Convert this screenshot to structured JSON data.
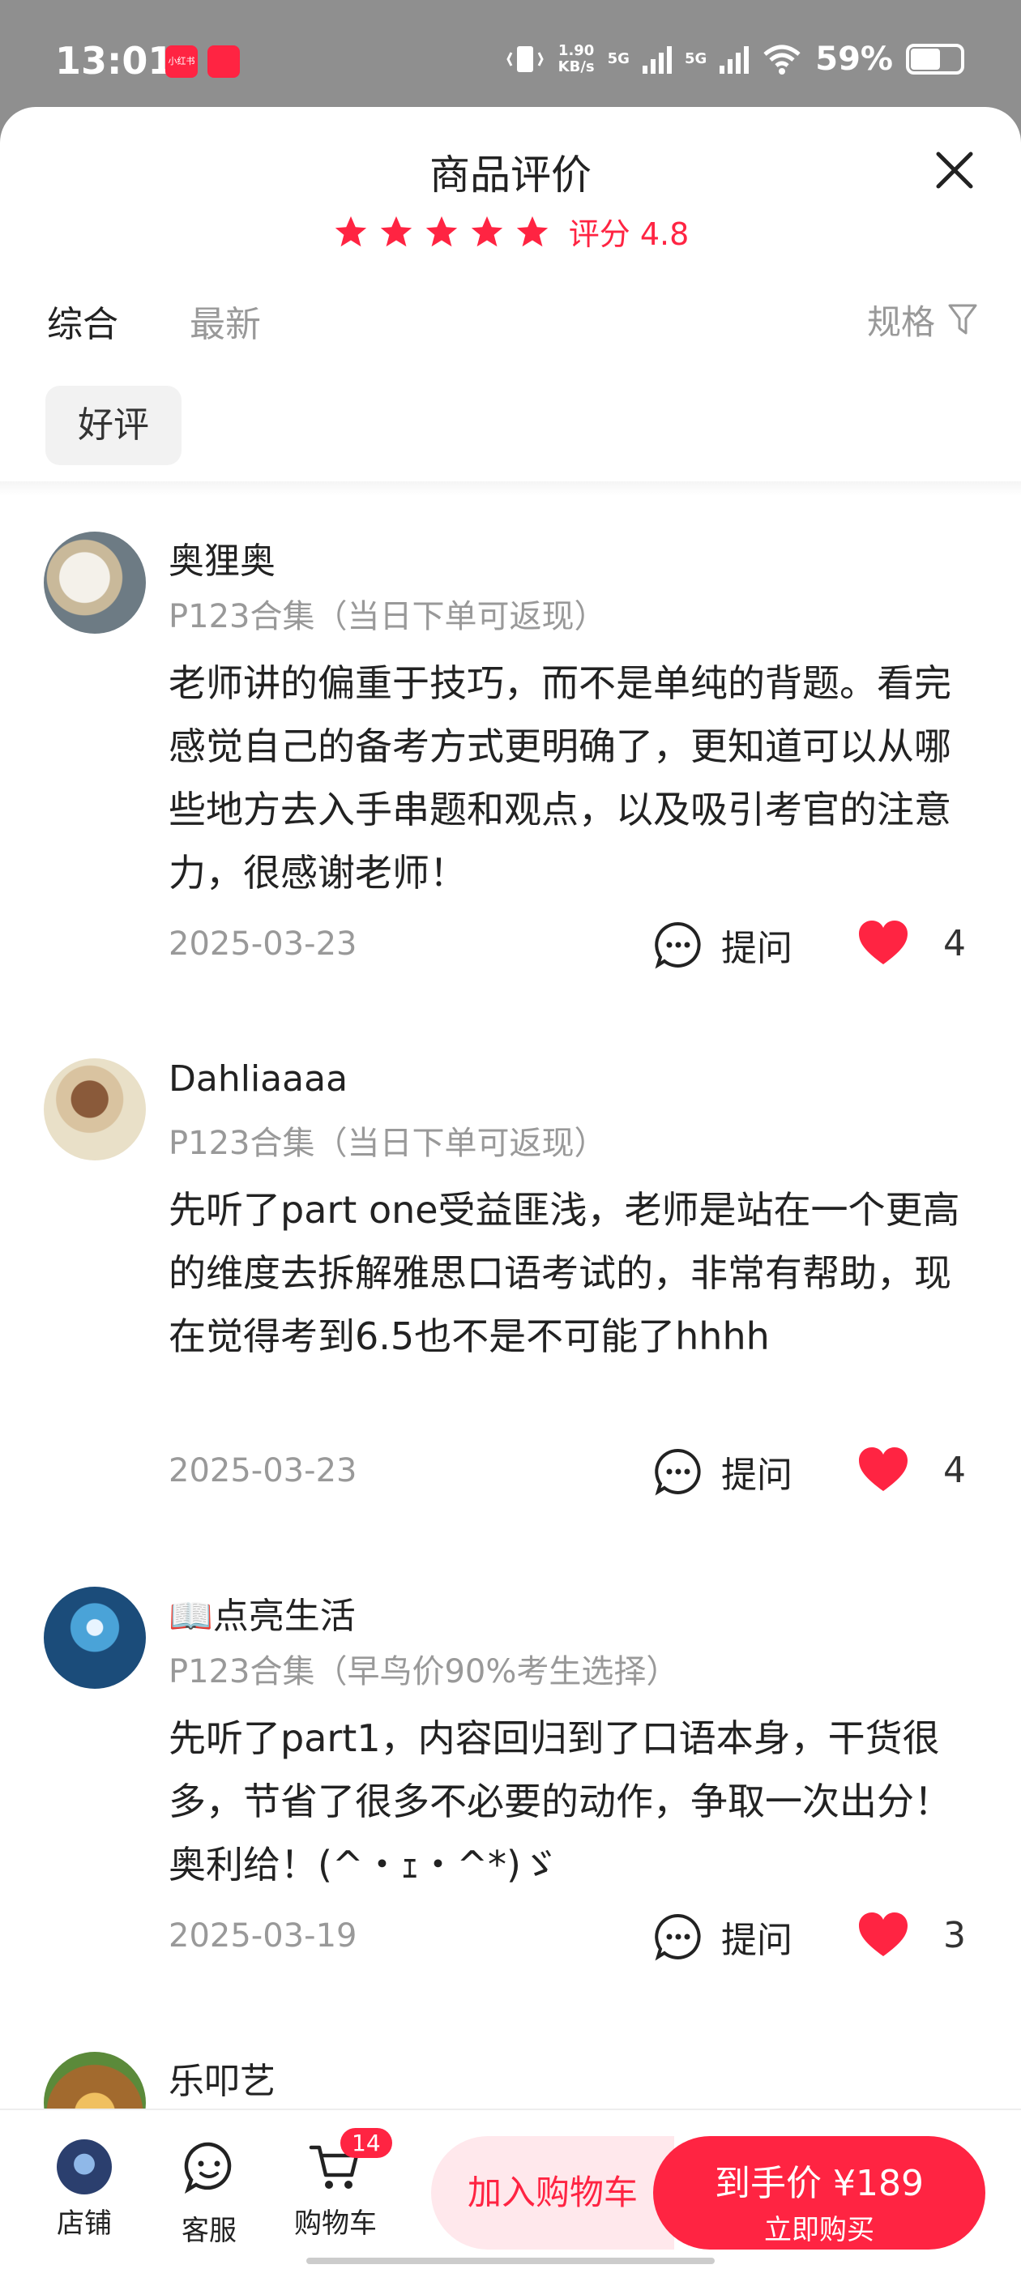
{
  "status_bar": {
    "time": "13:01",
    "net_speed_top": "1.90",
    "net_speed_bottom": "KB/s",
    "sim1": "5G",
    "sim2": "5G",
    "battery": "59%",
    "app1_label": "小红书"
  },
  "sheet": {
    "title": "商品评价",
    "rating_label": "评分 4.8",
    "rating_stars": 5,
    "accent_color": "#ff2442"
  },
  "tabs": {
    "comprehensive": "综合",
    "latest": "最新",
    "spec_filter": "规格"
  },
  "filter_chip": "好评",
  "reviews": [
    {
      "name": "奥狸奥",
      "spec": "P123合集（当日下单可返现）",
      "body": "老师讲的偏重于技巧，而不是单纯的背题。看完感觉自己的备考方式更明确了，更知道可以从哪些地方去入手串题和观点，以及吸引考官的注意力，很感谢老师！",
      "date": "2025-03-23",
      "ask_label": "提问",
      "likes": "4"
    },
    {
      "name": "Dahliaaaa",
      "spec": "P123合集（当日下单可返现）",
      "body": "先听了part one受益匪浅，老师是站在一个更高的维度去拆解雅思口语考试的，非常有帮助，现在觉得考到6.5也不是不可能了hhhh",
      "date": "2025-03-23",
      "ask_label": "提问",
      "likes": "4"
    },
    {
      "name": "📖点亮生活",
      "spec": "P123合集（早鸟价90%考生选择）",
      "body": "先听了part1，内容回归到了口语本身，干货很多，节省了很多不必要的动作，争取一次出分！奥利给！(^・ｪ・^*)ゞ",
      "date": "2025-03-19",
      "ask_label": "提问",
      "likes": "3"
    },
    {
      "name": "乐叩艺"
    }
  ],
  "bottom_bar": {
    "store": "店铺",
    "service": "客服",
    "cart": "购物车",
    "cart_badge": "14",
    "add_to_cart": "加入购物车",
    "price_label": "到手价 ¥189",
    "buy_now": "立即购买"
  }
}
